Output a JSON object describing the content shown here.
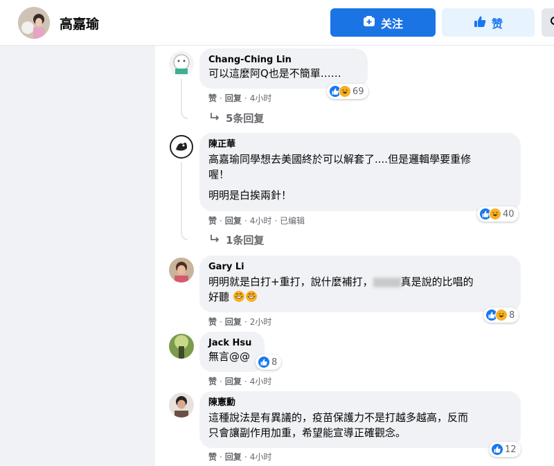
{
  "header": {
    "page_name": "高嘉瑜",
    "follow_label": "关注",
    "like_label": "赞"
  },
  "comments": [
    {
      "author": "Chang-Ching Lin",
      "text": [
        "可以這麼阿Q也是不簡單……"
      ],
      "reaction_count": "69",
      "like": "赞",
      "reply": "回复",
      "time": "4小时",
      "replies_label": "5条回复"
    },
    {
      "author": "陳正華",
      "text": [
        "高嘉瑜同學想去美國終於可以解套了....但是邏輯學要重修",
        "喔！",
        "明明是白挨兩針！"
      ],
      "reaction_count": "40",
      "like": "赞",
      "reply": "回复",
      "time": "4小时",
      "edited": "已编辑",
      "replies_label": "1条回复"
    },
    {
      "author": "Gary Li",
      "text": [
        "明明就是白打+重打，說什麼補打，",
        "真是說的比唱的",
        "好聽"
      ],
      "reaction_count": "8",
      "like": "赞",
      "reply": "回复",
      "time": "2小时"
    },
    {
      "author": "Jack Hsu",
      "text": [
        "無言@@"
      ],
      "reaction_count": "8",
      "like": "赞",
      "reply": "回复",
      "time": "4小时"
    },
    {
      "author": "陳憲勳",
      "text": [
        "這種說法是有異議的，疫苗保護力不是打越多越高，反而",
        "只會讓副作用加重，希望能宣導正確觀念。"
      ],
      "reaction_count": "12",
      "like": "赞",
      "reply": "回复",
      "time": "4小时"
    }
  ],
  "separator": "·",
  "colors": {
    "accent": "#1877f2",
    "follow_bg": "#1b74e4",
    "like_bg": "#e7f3ff",
    "bubble_bg": "#f0f2f5",
    "muted_text": "#65676b"
  },
  "icons": [
    "add-friend-icon",
    "thumbs-up-icon",
    "reply-arrow-icon",
    "like-reaction-icon",
    "haha-reaction-icon",
    "grin-emoji-icon"
  ]
}
